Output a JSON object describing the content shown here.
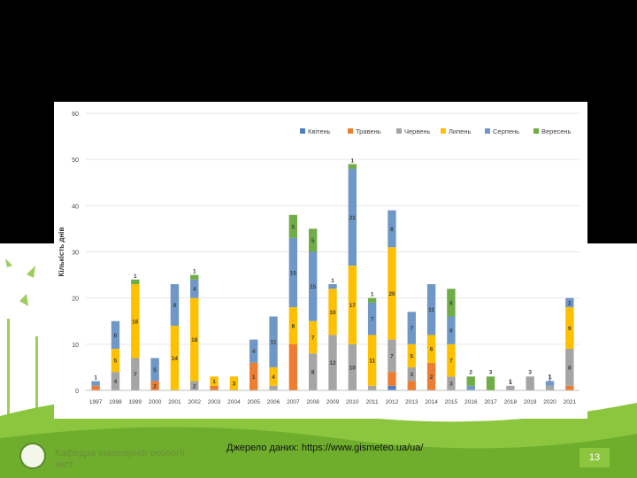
{
  "footer": {
    "department_line1": "Кафедра інженерної екології",
    "department_line2": "міст",
    "source": "Джерело даних: https://www.gismeteo.ua/ua/",
    "page_number": "13"
  },
  "chart_data": {
    "type": "bar",
    "stacked": true,
    "ylabel": "Кількість днів",
    "xlabel": "",
    "ylim": [
      0,
      60
    ],
    "yticks": [
      0,
      10,
      20,
      30,
      40,
      50,
      60
    ],
    "legend_position": "top-right",
    "grid": true,
    "categories": [
      "1997",
      "1998",
      "1999",
      "2000",
      "2001",
      "2002",
      "2003",
      "2004",
      "2005",
      "2006",
      "2007",
      "2008",
      "2009",
      "2010",
      "2011",
      "2012",
      "2013",
      "2014",
      "2015",
      "2016",
      "2017",
      "2018",
      "2019",
      "2020",
      "2021"
    ],
    "series": [
      {
        "name": "Квітень",
        "color": "#4e7fc0",
        "values": [
          0,
          0,
          0,
          0,
          0,
          0,
          0,
          0,
          0,
          0,
          0,
          0,
          0,
          0,
          0,
          1,
          0,
          0,
          0,
          0,
          0,
          0,
          0,
          0,
          0
        ],
        "labels": [
          null,
          null,
          null,
          null,
          null,
          null,
          null,
          null,
          null,
          null,
          null,
          null,
          null,
          null,
          null,
          null,
          null,
          null,
          null,
          null,
          null,
          null,
          null,
          null,
          null
        ]
      },
      {
        "name": "Травень",
        "color": "#ed7d31",
        "values": [
          1,
          0,
          0,
          2,
          0,
          0,
          1,
          0,
          6,
          0,
          10,
          0,
          0,
          0,
          0,
          3,
          2,
          6,
          0,
          0,
          0,
          0,
          0,
          0,
          1
        ],
        "labels": [
          null,
          null,
          null,
          "2",
          null,
          null,
          "1",
          null,
          "1",
          null,
          null,
          null,
          null,
          null,
          null,
          null,
          null,
          "2",
          null,
          null,
          null,
          null,
          null,
          null,
          null
        ]
      },
      {
        "name": "Червень",
        "color": "#a5a5a5",
        "values": [
          0,
          4,
          7,
          0,
          0,
          2,
          0,
          0,
          0,
          1,
          0,
          8,
          12,
          10,
          1,
          7,
          3,
          0,
          3,
          0,
          0,
          1,
          3,
          1,
          8
        ],
        "labels": [
          null,
          "4",
          "7",
          null,
          null,
          "2",
          null,
          null,
          null,
          "1",
          null,
          "8",
          "12",
          "10",
          "1",
          "7",
          "3",
          null,
          "3",
          null,
          null,
          "1",
          null,
          "1",
          "8"
        ]
      },
      {
        "name": "Липень",
        "color": "#ffc000",
        "values": [
          0,
          5,
          16,
          0,
          14,
          18,
          2,
          3,
          0,
          4,
          8,
          7,
          10,
          17,
          11,
          20,
          5,
          6,
          7,
          0,
          0,
          0,
          0,
          0,
          9
        ],
        "labels": [
          null,
          "5",
          "16",
          null,
          "14",
          "18",
          "1",
          "3",
          null,
          "4",
          "8",
          "7",
          "10",
          "17",
          "11",
          "20",
          "5",
          "6",
          "7",
          null,
          null,
          null,
          null,
          null,
          "9"
        ]
      },
      {
        "name": "Серпень",
        "color": "#6f98c9",
        "values": [
          1,
          6,
          0,
          5,
          9,
          4,
          0,
          0,
          5,
          11,
          15,
          15,
          1,
          21,
          7,
          8,
          7,
          11,
          6,
          1,
          0,
          0,
          0,
          1,
          2
        ],
        "labels": [
          "1",
          "6",
          null,
          "5",
          "9",
          "4",
          null,
          null,
          "4",
          "11",
          "15",
          "15",
          "1",
          "21",
          "7",
          "8",
          "7",
          "11",
          "6",
          null,
          null,
          null,
          null,
          "1",
          "2"
        ]
      },
      {
        "name": "Вересень",
        "color": "#70ad47",
        "values": [
          0,
          0,
          1,
          0,
          0,
          1,
          0,
          0,
          0,
          0,
          5,
          5,
          0,
          1,
          1,
          0,
          0,
          0,
          6,
          2,
          3,
          0,
          0,
          0,
          0
        ],
        "labels": [
          null,
          null,
          "1",
          null,
          null,
          "1",
          null,
          null,
          null,
          null,
          "5",
          "5",
          null,
          "1",
          "1",
          null,
          null,
          null,
          "6",
          null,
          null,
          null,
          null,
          null,
          null
        ]
      }
    ],
    "top_labels": [
      null,
      null,
      null,
      null,
      null,
      null,
      null,
      null,
      null,
      null,
      null,
      null,
      null,
      null,
      null,
      null,
      null,
      null,
      null,
      "2",
      "3",
      "1",
      "3",
      "1",
      null
    ]
  }
}
